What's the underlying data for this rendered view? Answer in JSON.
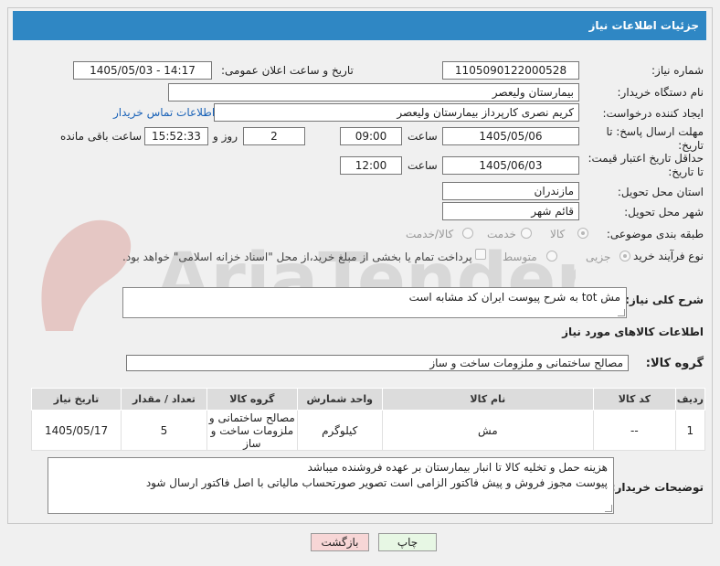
{
  "header": {
    "title": "جزئیات اطلاعات نیاز"
  },
  "fields": {
    "need_number_label": "شماره نیاز:",
    "need_number": "1105090122000528",
    "announce_label": "تاریخ و ساعت اعلان عمومی:",
    "announce_value": "1405/05/03 - 14:17",
    "buyer_org_label": "نام دستگاه خریدار:",
    "buyer_org": "بیمارستان ولیعصر",
    "creator_label": "ایجاد کننده درخواست:",
    "creator": "کریم نصری کارپرداز بیمارستان ولیعصر",
    "contact_link": "اطلاعات تماس خریدار",
    "deadline_label": "مهلت ارسال پاسخ: تا تاریخ:",
    "deadline_date": "1405/05/06",
    "time_label": "ساعت",
    "deadline_time": "09:00",
    "days_value": "2",
    "days_label": "روز و",
    "remaining_time": "15:52:33",
    "remaining_label": "ساعت باقی مانده",
    "price_validity_label": "حداقل تاریخ اعتبار قیمت: تا تاریخ:",
    "price_validity_date": "1405/06/03",
    "price_validity_time": "12:00",
    "province_label": "استان محل تحویل:",
    "province": "مازندران",
    "city_label": "شهر محل تحویل:",
    "city": "قائم شهر",
    "category_label": "طبقه بندی موضوعی:",
    "category_options": [
      "کالا",
      "خدمت",
      "کالا/خدمت"
    ],
    "process_label": "نوع فرآیند خرید :",
    "process_options": [
      "جزیی",
      "متوسط"
    ],
    "payment_note": "پرداخت تمام یا بخشی از مبلغ خرید،از محل \"اسناد خزانه اسلامی\" خواهد بود."
  },
  "summary": {
    "label": "شرح کلی نیاز:",
    "text": "مش tot به شرح پیوست   ایران کد مشابه است"
  },
  "goods_info": {
    "title": "اطلاعات کالاهای مورد نیاز",
    "group_label": "گروه کالا:",
    "group_value": "مصالح ساختمانی و ملزومات ساخت و ساز"
  },
  "table": {
    "headers": [
      "ردیف",
      "کد کالا",
      "نام کالا",
      "واحد شمارش",
      "گروه کالا",
      "تعداد / مقدار",
      "تاریخ نیاز"
    ],
    "rows": [
      [
        "1",
        "--",
        "مش",
        "کیلوگرم",
        "مصالح ساختمانی و ملزومات ساخت و ساز",
        "5",
        "1405/05/17"
      ]
    ]
  },
  "buyer_notes": {
    "label": "توضیحات خریدار:",
    "line1": "هزینه حمل و تخلیه کالا تا انبار بیمارستان بر عهده فروشنده میباشد",
    "line2": "پیوست مجوز فروش و پیش فاکتور الزامی است  تصویر صورتحساب مالیاتی با اصل فاکتور ارسال شود"
  },
  "buttons": {
    "print": "چاپ",
    "back": "بازگشت"
  },
  "watermark": {
    "text": "AriaTender.net"
  },
  "colors": {
    "header": "#2f87c4",
    "link": "#1b63b8",
    "back_button": "#f7d6d6",
    "print_button": "#e7f7e4"
  }
}
